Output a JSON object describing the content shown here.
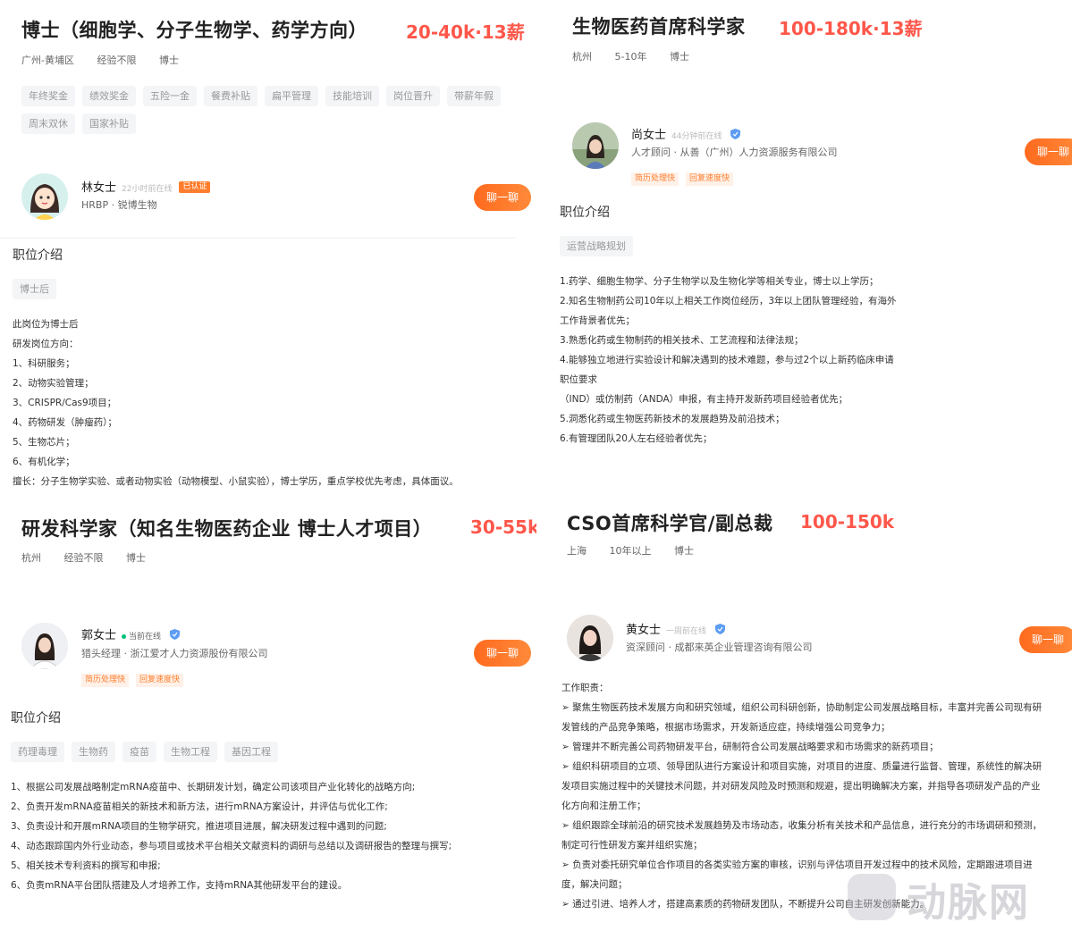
{
  "p1": {
    "title": "博士（细胞学、分子生物学、药学方向）",
    "salary": "20-40k·13薪",
    "meta": [
      "广州-黄埔区",
      "经验不限",
      "博士"
    ],
    "benefits": [
      "年终奖金",
      "绩效奖金",
      "五险一金",
      "餐费补贴",
      "扁平管理",
      "技能培训",
      "岗位晋升",
      "带薪年假",
      "周末双休",
      "国家补贴"
    ],
    "hr_name": "林女士",
    "hr_online": "22小时前在线",
    "hr_verified": "已认证",
    "hr_title": "HRBP · 锐博生物",
    "chat_label": "聊一聊",
    "section_title": "职位介绍",
    "tags": [
      "博士后"
    ],
    "desc": [
      "此岗位为博士后",
      "研发岗位方向：",
      "1、科研服务；",
      "2、动物实验管理；",
      "3、CRISPR/Cas9项目；",
      "4、药物研发（肿瘤药）；",
      "5、生物芯片；",
      "6、有机化学；",
      "擅长：分子生物学实验、或者动物实验（动物模型、小鼠实验），博士学历，重点学校优先考虑，具体面议。"
    ]
  },
  "p2": {
    "title": "生物医药首席科学家",
    "salary": "100-180k·13薪",
    "meta": [
      "杭州",
      "5-10年",
      "博士"
    ],
    "hr_name": "尚女士",
    "hr_online": "44分钟前在线",
    "hr_title": "人才顾问 · 从善（广州）人力资源服务有限公司",
    "badges": [
      "简历处理快",
      "回复速度快"
    ],
    "chat_label": "聊一聊",
    "section_title": "职位介绍",
    "tags": [
      "运营战略规划"
    ],
    "desc": [
      "1.药学、细胞生物学、分子生物学以及生物化学等相关专业，博士以上学历；",
      "2.知名生物制药公司10年以上相关工作岗位经历，3年以上团队管理经验，有海外",
      "工作背景者优先；",
      "3.熟悉化药或生物制药的相关技术、工艺流程和法律法规；",
      "4.能够独立地进行实验设计和解决遇到的技术难题，参与过2个以上新药临床申请",
      "职位要求",
      "（IND）或仿制药（ANDA）申报，有主持开发新药项目经验者优先；",
      "5.洞悉化药或生物医药新技术的发展趋势及前沿技术；",
      "6.有管理团队20人左右经验者优先；"
    ]
  },
  "p3": {
    "title": "研发科学家（知名生物医药企业 博士人才项目）",
    "salary": "30-55k",
    "meta": [
      "杭州",
      "经验不限",
      "博士"
    ],
    "hr_name": "郭女士",
    "hr_online": "当前在线",
    "hr_title": "猎头经理 · 浙江爱才人力资源股份有限公司",
    "badges": [
      "简历处理快",
      "回复速度快"
    ],
    "chat_label": "聊一聊",
    "section_title": "职位介绍",
    "tags": [
      "药理毒理",
      "生物药",
      "疫苗",
      "生物工程",
      "基因工程"
    ],
    "desc": [
      "1、根据公司发展战略制定mRNA疫苗中、长期研发计划，确定公司该项目产业化转化的战略方向;",
      "2、负责开发mRNA疫苗相关的新技术和新方法，进行mRNA方案设计，并评估与优化工作;",
      "3、负责设计和开展mRNA项目的生物学研究，推进项目进展，解决研发过程中遇到的问题;",
      "4、动态跟踪国内外行业动态，参与项目或技术平台相关文献资料的调研与总结以及调研报告的整理与撰写;",
      "5、相关技术专利资料的撰写和申报;",
      "6、负责mRNA平台团队搭建及人才培养工作，支持mRNA其他研发平台的建设。"
    ]
  },
  "p4": {
    "title": "CSO首席科学官/副总裁",
    "salary": "100-150k",
    "meta": [
      "上海",
      "10年以上",
      "博士"
    ],
    "hr_name": "黄女士",
    "hr_online": "一周前在线",
    "hr_title": "资深顾问 · 成都来英企业管理咨询有限公司",
    "chat_label": "聊一聊",
    "desc": [
      "工作职责：",
      "➢ 聚焦生物医药技术发展方向和研究领域，组织公司科研创新，协助制定公司发展战略目标，丰富并完善公司现有研",
      "发管线的产品竞争策略，根据市场需求，开发新适应症，持续增强公司竞争力；",
      "➢ 管理并不断完善公司药物研发平台，研制符合公司发展战略要求和市场需求的新药项目；",
      "➢ 组织科研项目的立项、领导团队进行方案设计和项目实施，对项目的进度、质量进行监督、管理，系统性的解决研",
      "发项目实施过程中的关键技术问题，并对研发风险及时预测和规避，提出明确解决方案，并指导各项研发产品的产业",
      "化方向和注册工作；",
      "➢ 组织跟踪全球前沿的研究技术发展趋势及市场动态，收集分析有关技术和产品信息，进行充分的市场调研和预测，",
      "制定可行性研发方案并组织实施；",
      "➢ 负责对委托研究单位合作项目的各类实验方案的审核，识别与评估项目开发过程中的技术风险，定期跟进项目进",
      "度，解决问题；",
      "➢ 通过引进、培养人才，搭建高素质的药物研发团队，不断提升公司自主研发创新能力。"
    ],
    "watermark": "动脉网"
  }
}
